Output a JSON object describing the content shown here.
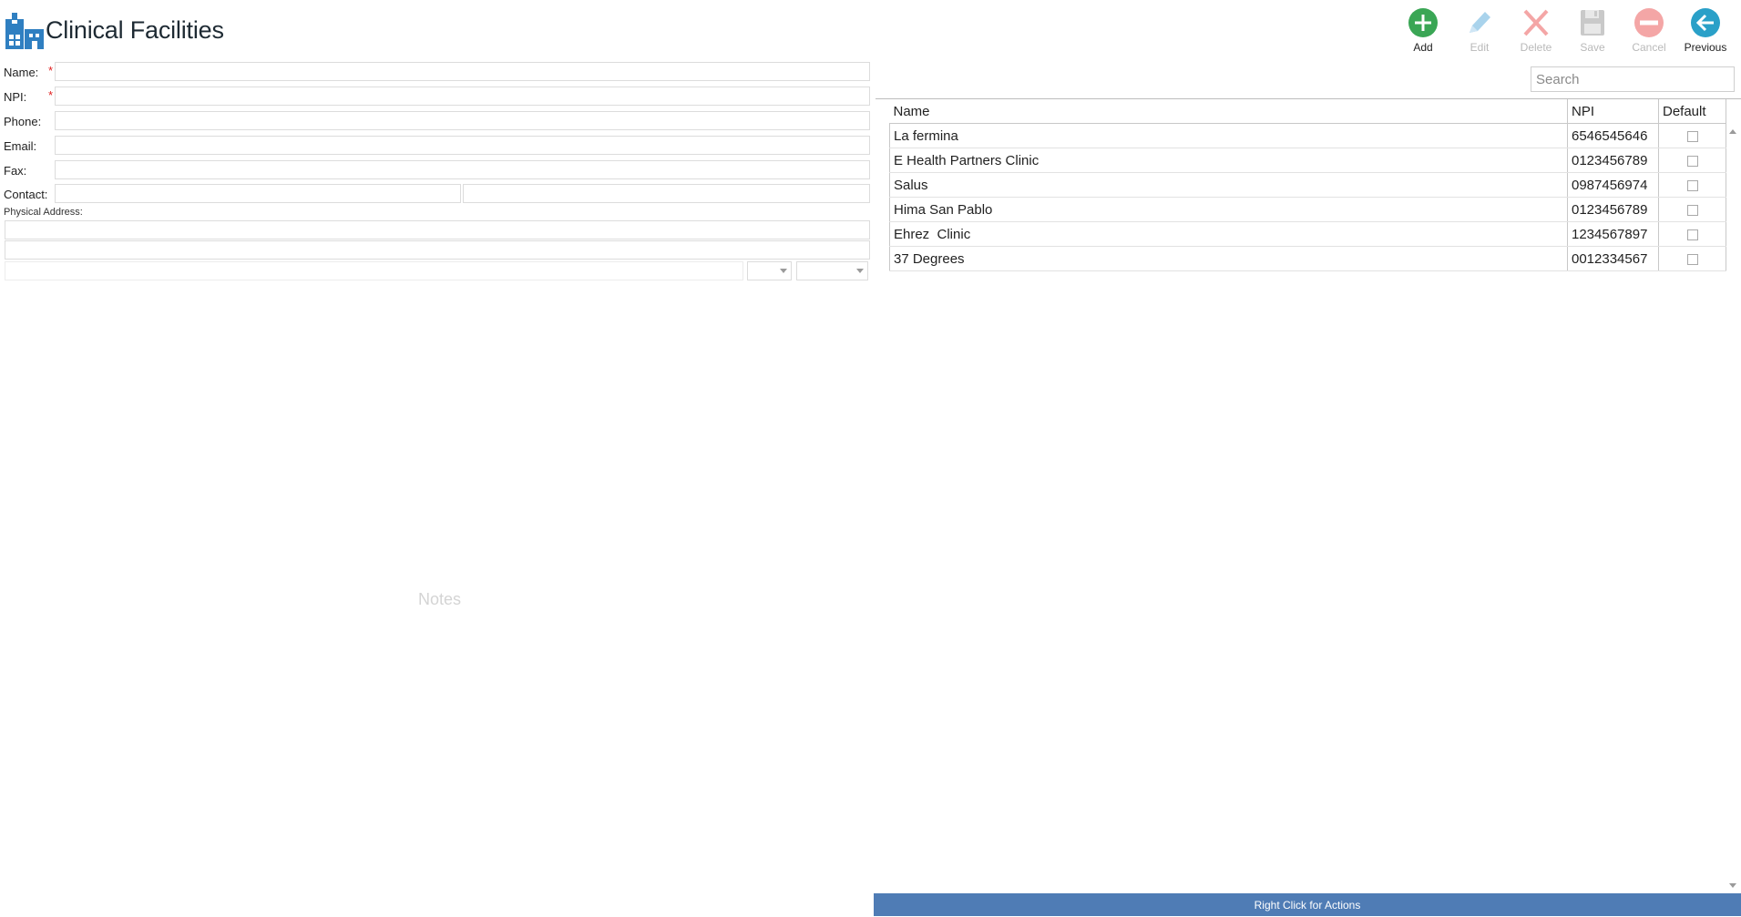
{
  "header": {
    "title": "Clinical Facilities",
    "app_icon": "hospital-icon"
  },
  "toolbar": {
    "buttons": [
      {
        "label": "Add",
        "icon": "add-circle-icon",
        "enabled": true,
        "color": "#3aa655"
      },
      {
        "label": "Edit",
        "icon": "pencil-icon",
        "enabled": false,
        "color": "#a9d3ec"
      },
      {
        "label": "Delete",
        "icon": "x-icon",
        "enabled": false,
        "color": "#f4a6a6"
      },
      {
        "label": "Save",
        "icon": "floppy-icon",
        "enabled": false,
        "color": "#c9c9c9"
      },
      {
        "label": "Cancel",
        "icon": "minus-circle-icon",
        "enabled": false,
        "color": "#f4a6a6"
      },
      {
        "label": "Previous",
        "icon": "arrow-left-circle-icon",
        "enabled": true,
        "color": "#2aa0c8"
      }
    ]
  },
  "form": {
    "name_label": "Name:",
    "npi_label": "NPI:",
    "phone_label": "Phone:",
    "email_label": "Email:",
    "fax_label": "Fax:",
    "contact_label": "Contact:",
    "required_marker": "*",
    "physical_address_label": "Physical Address:",
    "notes_placeholder": "Notes"
  },
  "search": {
    "placeholder": "Search"
  },
  "grid": {
    "columns": [
      "Name",
      "NPI",
      "Default"
    ],
    "rows": [
      {
        "name": "La fermina",
        "npi": "6546545646",
        "default": false
      },
      {
        "name": "E Health Partners Clinic",
        "npi": "0123456789",
        "default": false
      },
      {
        "name": "Salus",
        "npi": "0987456974",
        "default": false
      },
      {
        "name": "Hima San Pablo",
        "npi": "0123456789",
        "default": false
      },
      {
        "name": "Ehrez  Clinic",
        "npi": "1234567897",
        "default": false
      },
      {
        "name": "37 Degrees",
        "npi": "0012334567",
        "default": false
      }
    ]
  },
  "action_bar": {
    "label": "Right Click for Actions",
    "color": "#4f7cb5"
  }
}
